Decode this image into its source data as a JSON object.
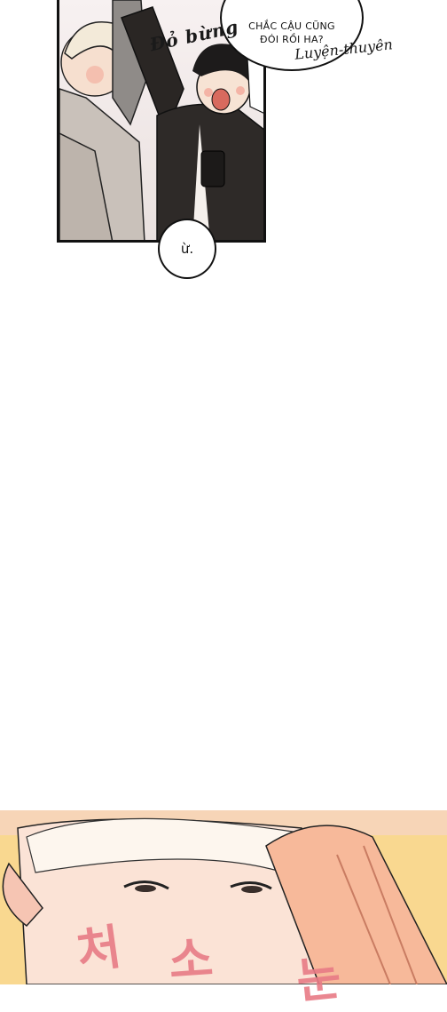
{
  "top_panel": {
    "speech_text_line1": "CHẮC CẬU CŨNG",
    "speech_text_line2": "ĐÓI RỒI HA?",
    "sfx_blush": "Đỏ bừng",
    "credit": "Luyện-thuyên",
    "reply_bubble": "ừ."
  },
  "bottom_panel": {
    "korean_sfx": [
      "처",
      "소",
      "눈"
    ]
  },
  "colors": {
    "bottom_bg": "#f9d890",
    "sfx_pink": "#e87b86"
  }
}
